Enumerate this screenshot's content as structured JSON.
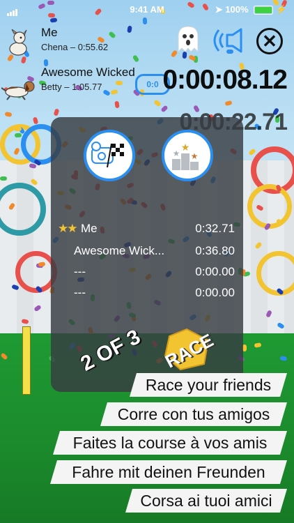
{
  "status_bar": {
    "time": "9:41 AM",
    "battery": "100%"
  },
  "players": [
    {
      "name": "Me",
      "subtitle": "Chena – 0:55.62"
    },
    {
      "name": "Awesome Wicked",
      "subtitle": "Betty – 1:05.77"
    }
  ],
  "lap_button": "0:0",
  "timers": {
    "main": "0:00:08.12",
    "ghost": "0:00:22.71"
  },
  "results": [
    {
      "stars": "★★",
      "name": "Me",
      "time": "0:32.71"
    },
    {
      "stars": "",
      "name": "Awesome Wick...",
      "time": "0:36.80"
    },
    {
      "stars": "",
      "name": "---",
      "time": "0:00.00"
    },
    {
      "stars": "",
      "name": "---",
      "time": "0:00.00"
    }
  ],
  "round_label": "2 OF 3",
  "race_label": "RACE",
  "banners": [
    "Race your friends",
    "Corre con tus amigos",
    "Faites la course à vos amis",
    "Fahre mit deinen Freunden",
    "Corsa ai tuoi amici"
  ],
  "icons": {
    "ghost": "ghost-icon",
    "sound": "speaker-icon",
    "close": "close-icon",
    "race_badge": "checkered-flag-dogs-icon",
    "podium_badge": "podium-stars-icon"
  },
  "colors": {
    "accent": "#2a8ff0",
    "grass": "#1b8a2c",
    "star": "#f2c431"
  }
}
